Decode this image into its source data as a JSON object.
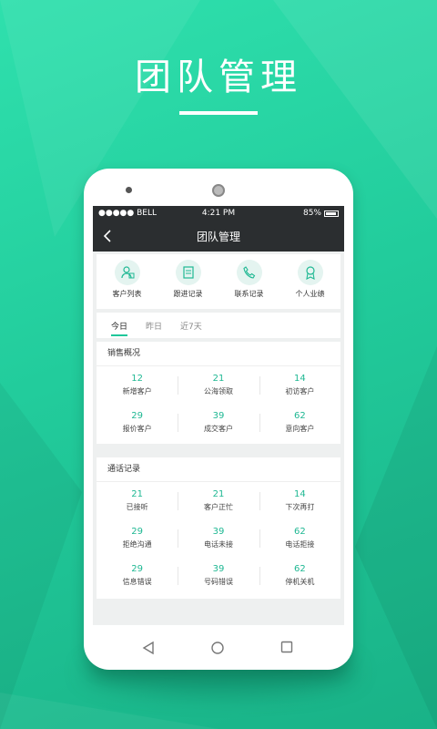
{
  "hero": {
    "title": "团队管理"
  },
  "status": {
    "carrier": "●●●●● BELL",
    "time": "4:21 PM",
    "battery": "85%"
  },
  "nav": {
    "title": "团队管理"
  },
  "quick": [
    {
      "label": "客户列表",
      "icon": "customer-list-icon"
    },
    {
      "label": "跟进记录",
      "icon": "follow-record-icon"
    },
    {
      "label": "联系记录",
      "icon": "phone-icon"
    },
    {
      "label": "个人业绩",
      "icon": "award-icon"
    }
  ],
  "tabs": [
    "今日",
    "昨日",
    "近7天"
  ],
  "sales": {
    "title": "销售概况",
    "items": [
      {
        "value": "12",
        "label": "新增客户"
      },
      {
        "value": "21",
        "label": "公海领取"
      },
      {
        "value": "14",
        "label": "初访客户"
      },
      {
        "value": "29",
        "label": "报价客户"
      },
      {
        "value": "39",
        "label": "成交客户"
      },
      {
        "value": "62",
        "label": "意向客户"
      }
    ]
  },
  "calls": {
    "title": "通话记录",
    "items": [
      {
        "value": "21",
        "label": "已接听"
      },
      {
        "value": "21",
        "label": "客户正忙"
      },
      {
        "value": "14",
        "label": "下次再打"
      },
      {
        "value": "29",
        "label": "拒绝沟通"
      },
      {
        "value": "39",
        "label": "电话未接"
      },
      {
        "value": "62",
        "label": "电话拒接"
      },
      {
        "value": "29",
        "label": "信息错误"
      },
      {
        "value": "39",
        "label": "号码错误"
      },
      {
        "value": "62",
        "label": "停机关机"
      }
    ]
  },
  "colors": {
    "accent": "#1fb893",
    "background": "#22cc9c"
  }
}
